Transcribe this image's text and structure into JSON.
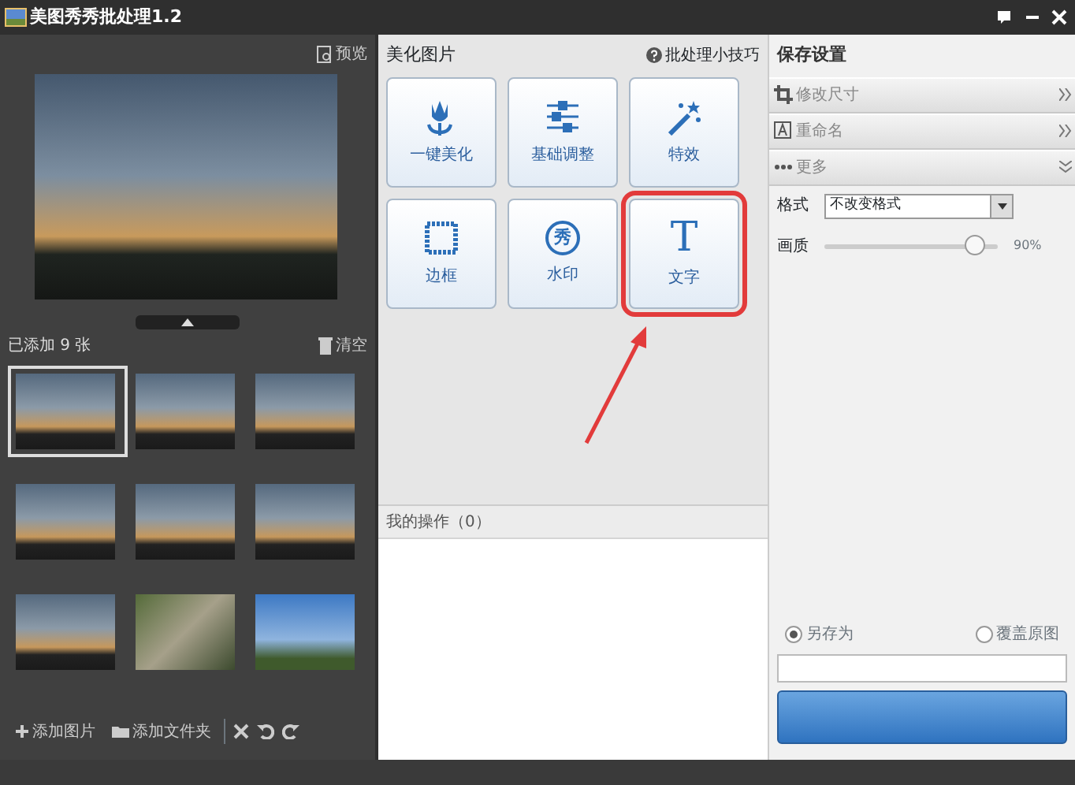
{
  "window": {
    "title": "美图秀秀批处理1.2"
  },
  "left_panel": {
    "preview_link": "预览",
    "added_count": "已添加 9 张",
    "clear_button": "清空",
    "thumbnails": [
      {
        "kind": "sunset",
        "selected": true
      },
      {
        "kind": "sunset",
        "selected": false
      },
      {
        "kind": "sunset",
        "selected": false
      },
      {
        "kind": "sunset",
        "selected": false
      },
      {
        "kind": "sunset",
        "selected": false
      },
      {
        "kind": "sunset",
        "selected": false
      },
      {
        "kind": "sunset",
        "selected": false
      },
      {
        "kind": "food",
        "selected": false
      },
      {
        "kind": "sky",
        "selected": false
      }
    ],
    "toolbar": {
      "add_images": "添加图片",
      "add_folder": "添加文件夹"
    }
  },
  "beautify": {
    "title": "美化图片",
    "tips_link": "批处理小技巧",
    "tools": [
      {
        "label": "一键美化",
        "kind": "tulip",
        "highlighted": false
      },
      {
        "label": "基础调整",
        "kind": "sliders",
        "highlighted": false
      },
      {
        "label": "特效",
        "kind": "wand",
        "highlighted": false
      },
      {
        "label": "边框",
        "kind": "frame",
        "highlighted": false
      },
      {
        "label": "水印",
        "kind": "seal",
        "glyph": "秀",
        "highlighted": false
      },
      {
        "label": "文字",
        "kind": "letter",
        "glyph": "T",
        "highlighted": true
      }
    ],
    "operations_title": "我的操作（0）"
  },
  "save_settings": {
    "title": "保存设置",
    "sections": [
      {
        "label": "修改尺寸",
        "kind": "crop",
        "expanded": false
      },
      {
        "label": "重命名",
        "kind": "rename",
        "expanded": false
      },
      {
        "label": "更多",
        "kind": "dots",
        "expanded": true
      }
    ],
    "format_label": "格式",
    "format_value": "不改变格式",
    "quality_label": "画质",
    "quality": {
      "level": 0.86
    },
    "quality_reading": "90%",
    "save_modes": [
      {
        "label": "另存为",
        "selected": true
      },
      {
        "label": "覆盖原图",
        "selected": false
      }
    ]
  }
}
